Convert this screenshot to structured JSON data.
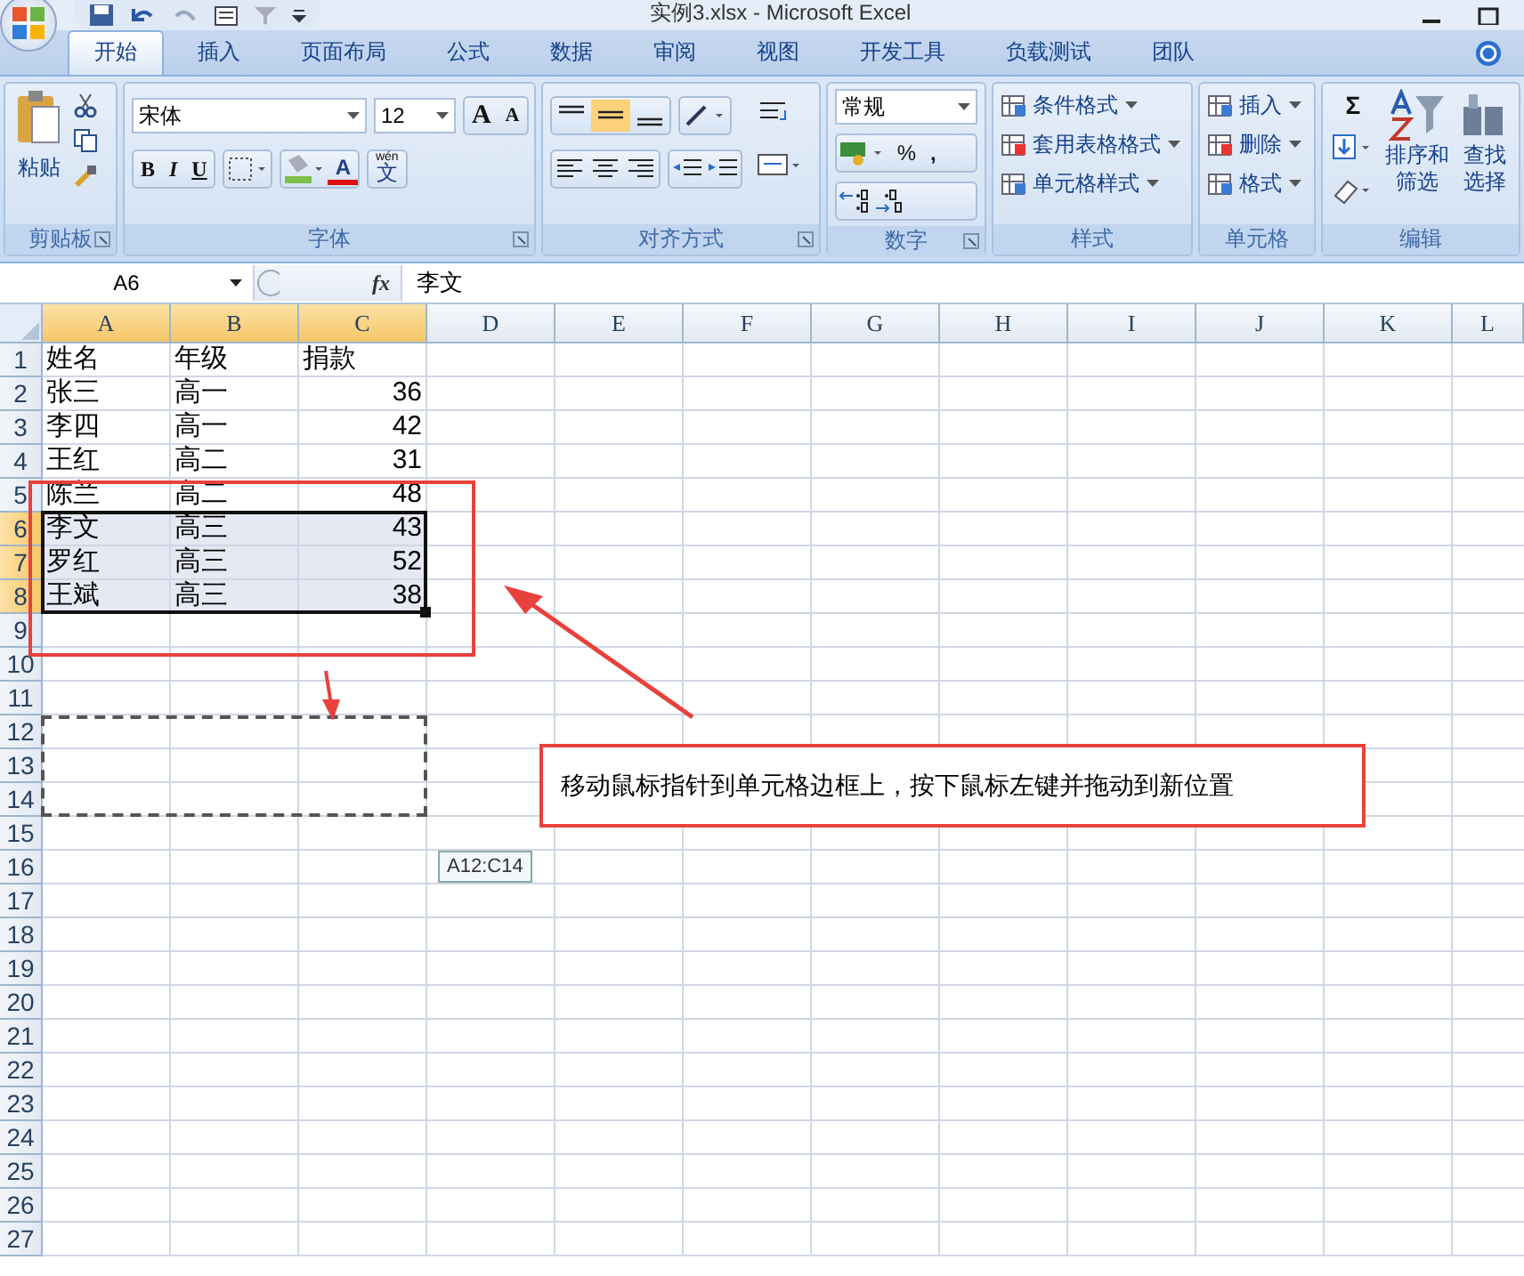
{
  "window": {
    "title": "实例3.xlsx - Microsoft Excel"
  },
  "tabs": [
    {
      "label": "开始",
      "selected": true
    },
    {
      "label": "插入",
      "selected": false
    },
    {
      "label": "页面布局",
      "selected": false
    },
    {
      "label": "公式",
      "selected": false
    },
    {
      "label": "数据",
      "selected": false
    },
    {
      "label": "审阅",
      "selected": false
    },
    {
      "label": "视图",
      "selected": false
    },
    {
      "label": "开发工具",
      "selected": false
    },
    {
      "label": "负载测试",
      "selected": false
    },
    {
      "label": "团队",
      "selected": false
    }
  ],
  "groups": [
    {
      "kind": "clipboard",
      "label": "剪贴板",
      "paste": "粘贴"
    },
    {
      "kind": "font",
      "label": "字体",
      "font_name": "宋体",
      "font_size": "12",
      "grow": "A",
      "shrink": "A",
      "bold": "B",
      "italic": "I",
      "underline": "U",
      "font_color": "A",
      "phonetic_ruby": "wén",
      "phonetic_char": "文"
    },
    {
      "kind": "alignment",
      "label": "对齐方式",
      "vertical": [
        {
          "selected": false
        },
        {
          "selected": true
        },
        {
          "selected": false
        }
      ]
    },
    {
      "kind": "number",
      "label": "数字",
      "format": "常规",
      "percent": "%",
      "comma": ","
    },
    {
      "kind": "styles",
      "label": "样式",
      "items": [
        "条件格式",
        "套用表格格式",
        "单元格样式"
      ]
    },
    {
      "kind": "cells",
      "label": "单元格",
      "items": [
        "插入",
        "删除",
        "格式"
      ]
    },
    {
      "kind": "editing",
      "label": "编辑",
      "sum": "Σ",
      "sort": [
        "排序和",
        "筛选"
      ],
      "find": [
        "查找",
        "选择"
      ]
    }
  ],
  "formula_bar": {
    "name_box": "A6",
    "fx": "fx",
    "value": "李文"
  },
  "sheet": {
    "columns": [
      {
        "label": "A",
        "selected": true
      },
      {
        "label": "B",
        "selected": true
      },
      {
        "label": "C",
        "selected": true
      },
      {
        "label": "D",
        "selected": false
      },
      {
        "label": "E",
        "selected": false
      },
      {
        "label": "F",
        "selected": false
      },
      {
        "label": "G",
        "selected": false
      },
      {
        "label": "H",
        "selected": false
      },
      {
        "label": "I",
        "selected": false
      },
      {
        "label": "J",
        "selected": false
      },
      {
        "label": "K",
        "selected": false
      },
      {
        "label": "L",
        "selected": false
      }
    ],
    "rows": [
      {
        "label": "1",
        "selected": false,
        "cells": [
          {
            "text": "姓名",
            "kind": "text"
          },
          {
            "text": "年级",
            "kind": "text"
          },
          {
            "text": "捐款",
            "kind": "text"
          }
        ]
      },
      {
        "label": "2",
        "selected": false,
        "cells": [
          {
            "text": "张三",
            "kind": "text"
          },
          {
            "text": "高一",
            "kind": "text"
          },
          {
            "text": "36",
            "kind": "number"
          }
        ]
      },
      {
        "label": "3",
        "selected": false,
        "cells": [
          {
            "text": "李四",
            "kind": "text"
          },
          {
            "text": "高一",
            "kind": "text"
          },
          {
            "text": "42",
            "kind": "number"
          }
        ]
      },
      {
        "label": "4",
        "selected": false,
        "cells": [
          {
            "text": "王红",
            "kind": "text"
          },
          {
            "text": "高二",
            "kind": "text"
          },
          {
            "text": "31",
            "kind": "number"
          }
        ]
      },
      {
        "label": "5",
        "selected": false,
        "cells": [
          {
            "text": "陈兰",
            "kind": "text"
          },
          {
            "text": "高二",
            "kind": "text"
          },
          {
            "text": "48",
            "kind": "number"
          }
        ]
      },
      {
        "label": "6",
        "selected": true,
        "cells": [
          {
            "text": "李文",
            "kind": "text"
          },
          {
            "text": "高三",
            "kind": "text"
          },
          {
            "text": "43",
            "kind": "number"
          }
        ]
      },
      {
        "label": "7",
        "selected": true,
        "cells": [
          {
            "text": "罗红",
            "kind": "text"
          },
          {
            "text": "高三",
            "kind": "text"
          },
          {
            "text": "52",
            "kind": "number"
          }
        ]
      },
      {
        "label": "8",
        "selected": true,
        "cells": [
          {
            "text": "王斌",
            "kind": "text"
          },
          {
            "text": "高三",
            "kind": "text"
          },
          {
            "text": "38",
            "kind": "number"
          }
        ]
      },
      {
        "label": "9",
        "selected": false,
        "cells": []
      },
      {
        "label": "10",
        "selected": false,
        "cells": []
      },
      {
        "label": "11",
        "selected": false,
        "cells": []
      },
      {
        "label": "12",
        "selected": false,
        "cells": []
      },
      {
        "label": "13",
        "selected": false,
        "cells": []
      },
      {
        "label": "14",
        "selected": false,
        "cells": []
      },
      {
        "label": "15",
        "selected": false,
        "cells": []
      },
      {
        "label": "16",
        "selected": false,
        "cells": []
      },
      {
        "label": "17",
        "selected": false,
        "cells": []
      },
      {
        "label": "18",
        "selected": false,
        "cells": []
      },
      {
        "label": "19",
        "selected": false,
        "cells": []
      },
      {
        "label": "20",
        "selected": false,
        "cells": []
      },
      {
        "label": "21",
        "selected": false,
        "cells": []
      },
      {
        "label": "22",
        "selected": false,
        "cells": []
      },
      {
        "label": "23",
        "selected": false,
        "cells": []
      },
      {
        "label": "24",
        "selected": false,
        "cells": []
      },
      {
        "label": "25",
        "selected": false,
        "cells": []
      },
      {
        "label": "26",
        "selected": false,
        "cells": []
      },
      {
        "label": "27",
        "selected": false,
        "cells": []
      }
    ]
  },
  "drag_tooltip": "A12:C14",
  "callout": "移动鼠标指针到单元格边框上，按下鼠标左键并拖动到新位置"
}
